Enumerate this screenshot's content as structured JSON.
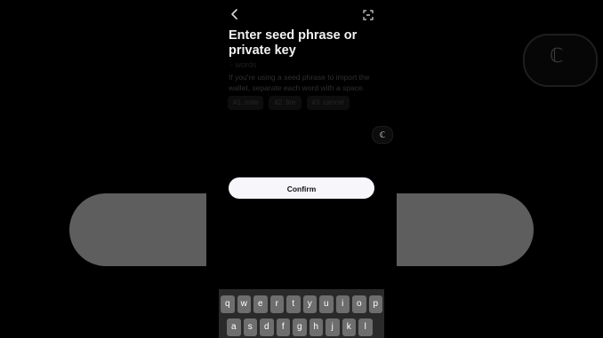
{
  "background": {
    "ghost_glyph": "ℂ"
  },
  "header": {
    "back_icon": "chevron-left-icon",
    "scan_icon": "scan-icon"
  },
  "title": "Enter seed phrase or private key",
  "ghost_label": "· words",
  "hint": "If you're using a seed phrase to import the wallet, separate each word with a space.",
  "chips": [
    {
      "num": "#1",
      "word": "note"
    },
    {
      "num": "#2",
      "word": "fire"
    },
    {
      "num": "#3",
      "word": "cancel"
    }
  ],
  "paste_glyph": "ℂ",
  "confirm_label": "Confirm",
  "keyboard": {
    "row1": [
      "q",
      "w",
      "e",
      "r",
      "t",
      "y",
      "u",
      "i",
      "o",
      "p"
    ],
    "row2": [
      "a",
      "s",
      "d",
      "f",
      "g",
      "h",
      "j",
      "k",
      "l"
    ]
  },
  "colors": {
    "background": "#000000",
    "confirm_bg": "#f7f6fb",
    "keyboard_bg": "#2a2a2a",
    "key_bg": "#6e6e6e"
  }
}
